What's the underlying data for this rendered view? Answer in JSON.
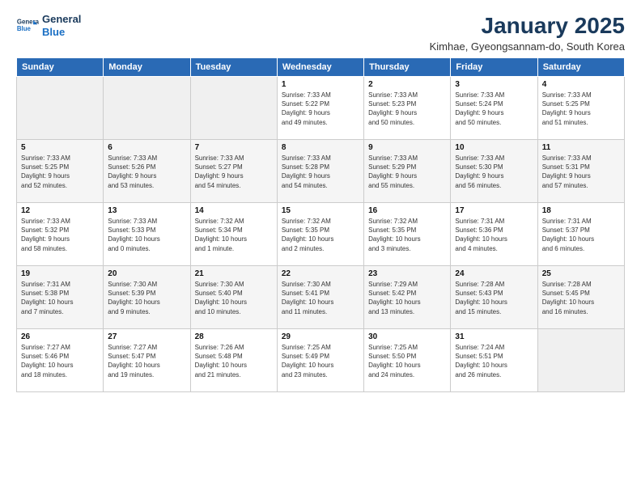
{
  "logo": {
    "line1": "General",
    "line2": "Blue"
  },
  "title": "January 2025",
  "subtitle": "Kimhae, Gyeongsannam-do, South Korea",
  "weekdays": [
    "Sunday",
    "Monday",
    "Tuesday",
    "Wednesday",
    "Thursday",
    "Friday",
    "Saturday"
  ],
  "weeks": [
    [
      {
        "day": "",
        "info": "",
        "other": true
      },
      {
        "day": "",
        "info": "",
        "other": true
      },
      {
        "day": "",
        "info": "",
        "other": true
      },
      {
        "day": "1",
        "info": "Sunrise: 7:33 AM\nSunset: 5:22 PM\nDaylight: 9 hours\nand 49 minutes."
      },
      {
        "day": "2",
        "info": "Sunrise: 7:33 AM\nSunset: 5:23 PM\nDaylight: 9 hours\nand 50 minutes."
      },
      {
        "day": "3",
        "info": "Sunrise: 7:33 AM\nSunset: 5:24 PM\nDaylight: 9 hours\nand 50 minutes."
      },
      {
        "day": "4",
        "info": "Sunrise: 7:33 AM\nSunset: 5:25 PM\nDaylight: 9 hours\nand 51 minutes."
      }
    ],
    [
      {
        "day": "5",
        "info": "Sunrise: 7:33 AM\nSunset: 5:25 PM\nDaylight: 9 hours\nand 52 minutes."
      },
      {
        "day": "6",
        "info": "Sunrise: 7:33 AM\nSunset: 5:26 PM\nDaylight: 9 hours\nand 53 minutes."
      },
      {
        "day": "7",
        "info": "Sunrise: 7:33 AM\nSunset: 5:27 PM\nDaylight: 9 hours\nand 54 minutes."
      },
      {
        "day": "8",
        "info": "Sunrise: 7:33 AM\nSunset: 5:28 PM\nDaylight: 9 hours\nand 54 minutes."
      },
      {
        "day": "9",
        "info": "Sunrise: 7:33 AM\nSunset: 5:29 PM\nDaylight: 9 hours\nand 55 minutes."
      },
      {
        "day": "10",
        "info": "Sunrise: 7:33 AM\nSunset: 5:30 PM\nDaylight: 9 hours\nand 56 minutes."
      },
      {
        "day": "11",
        "info": "Sunrise: 7:33 AM\nSunset: 5:31 PM\nDaylight: 9 hours\nand 57 minutes."
      }
    ],
    [
      {
        "day": "12",
        "info": "Sunrise: 7:33 AM\nSunset: 5:32 PM\nDaylight: 9 hours\nand 58 minutes."
      },
      {
        "day": "13",
        "info": "Sunrise: 7:33 AM\nSunset: 5:33 PM\nDaylight: 10 hours\nand 0 minutes."
      },
      {
        "day": "14",
        "info": "Sunrise: 7:32 AM\nSunset: 5:34 PM\nDaylight: 10 hours\nand 1 minute."
      },
      {
        "day": "15",
        "info": "Sunrise: 7:32 AM\nSunset: 5:35 PM\nDaylight: 10 hours\nand 2 minutes."
      },
      {
        "day": "16",
        "info": "Sunrise: 7:32 AM\nSunset: 5:35 PM\nDaylight: 10 hours\nand 3 minutes."
      },
      {
        "day": "17",
        "info": "Sunrise: 7:31 AM\nSunset: 5:36 PM\nDaylight: 10 hours\nand 4 minutes."
      },
      {
        "day": "18",
        "info": "Sunrise: 7:31 AM\nSunset: 5:37 PM\nDaylight: 10 hours\nand 6 minutes."
      }
    ],
    [
      {
        "day": "19",
        "info": "Sunrise: 7:31 AM\nSunset: 5:38 PM\nDaylight: 10 hours\nand 7 minutes."
      },
      {
        "day": "20",
        "info": "Sunrise: 7:30 AM\nSunset: 5:39 PM\nDaylight: 10 hours\nand 9 minutes."
      },
      {
        "day": "21",
        "info": "Sunrise: 7:30 AM\nSunset: 5:40 PM\nDaylight: 10 hours\nand 10 minutes."
      },
      {
        "day": "22",
        "info": "Sunrise: 7:30 AM\nSunset: 5:41 PM\nDaylight: 10 hours\nand 11 minutes."
      },
      {
        "day": "23",
        "info": "Sunrise: 7:29 AM\nSunset: 5:42 PM\nDaylight: 10 hours\nand 13 minutes."
      },
      {
        "day": "24",
        "info": "Sunrise: 7:28 AM\nSunset: 5:43 PM\nDaylight: 10 hours\nand 15 minutes."
      },
      {
        "day": "25",
        "info": "Sunrise: 7:28 AM\nSunset: 5:45 PM\nDaylight: 10 hours\nand 16 minutes."
      }
    ],
    [
      {
        "day": "26",
        "info": "Sunrise: 7:27 AM\nSunset: 5:46 PM\nDaylight: 10 hours\nand 18 minutes."
      },
      {
        "day": "27",
        "info": "Sunrise: 7:27 AM\nSunset: 5:47 PM\nDaylight: 10 hours\nand 19 minutes."
      },
      {
        "day": "28",
        "info": "Sunrise: 7:26 AM\nSunset: 5:48 PM\nDaylight: 10 hours\nand 21 minutes."
      },
      {
        "day": "29",
        "info": "Sunrise: 7:25 AM\nSunset: 5:49 PM\nDaylight: 10 hours\nand 23 minutes."
      },
      {
        "day": "30",
        "info": "Sunrise: 7:25 AM\nSunset: 5:50 PM\nDaylight: 10 hours\nand 24 minutes."
      },
      {
        "day": "31",
        "info": "Sunrise: 7:24 AM\nSunset: 5:51 PM\nDaylight: 10 hours\nand 26 minutes."
      },
      {
        "day": "",
        "info": "",
        "other": true
      }
    ]
  ]
}
